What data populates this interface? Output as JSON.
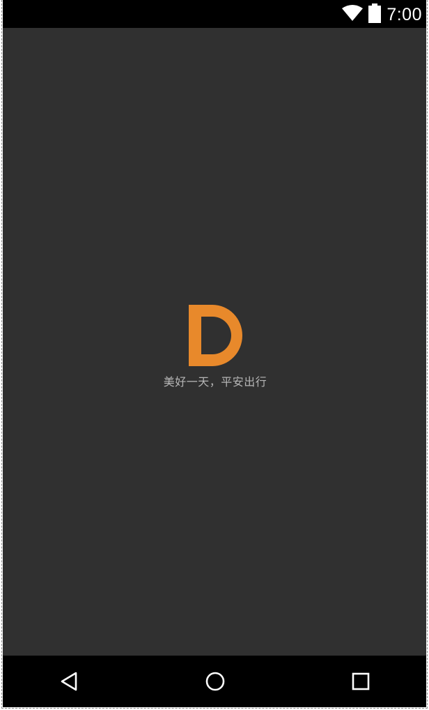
{
  "status_bar": {
    "time": "7:00",
    "icons": [
      "wifi-icon",
      "battery-icon"
    ]
  },
  "splash": {
    "logo_letter": "D",
    "logo_color": "#E8892B",
    "tagline": "美好一天，平安出行",
    "background_color": "#303030"
  },
  "nav_bar": {
    "buttons": [
      "back-icon",
      "home-icon",
      "recents-icon"
    ]
  }
}
